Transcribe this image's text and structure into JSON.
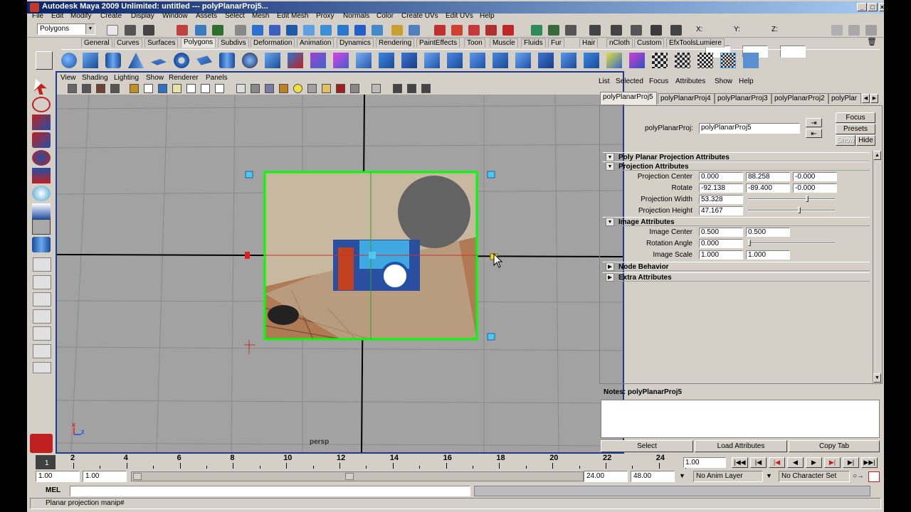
{
  "window": {
    "title": "Autodesk Maya 2009 Unlimited: untitled   ---   polyPlanarProj5...",
    "min_glyph": "_",
    "max_glyph": "□",
    "close_glyph": "×"
  },
  "menubar": [
    "File",
    "Edit",
    "Modify",
    "Create",
    "Display",
    "Window",
    "Assets",
    "Select",
    "Mesh",
    "Edit Mesh",
    "Proxy",
    "Normals",
    "Color",
    "Create UVs",
    "Edit UVs",
    "Help"
  ],
  "statusline": {
    "menu_set": "Polygons",
    "x_label": "X:",
    "y_label": "Y:",
    "z_label": "Z:"
  },
  "shelf_tabs": [
    "General",
    "Curves",
    "Surfaces",
    "Polygons",
    "Subdivs",
    "Deformation",
    "Animation",
    "Dynamics",
    "Rendering",
    "PaintEffects",
    "Toon",
    "Muscle",
    "Fluids",
    "Fur",
    "Hair",
    "nCloth",
    "Custom",
    "EfxToolsLumiere"
  ],
  "panel": {
    "menu": [
      "View",
      "Shading",
      "Lighting",
      "Show",
      "Renderer",
      "Panels"
    ],
    "camera_label": "persp",
    "axis_x": "x",
    "axis_z": "z"
  },
  "attribute_editor": {
    "menu": [
      "List",
      "Selected",
      "Focus",
      "Attributes",
      "Show",
      "Help"
    ],
    "tabs": [
      "polyPlanarProj5",
      "polyPlanarProj4",
      "polyPlanarProj3",
      "polyPlanarProj2",
      "polyPlar"
    ],
    "node_label": "polyPlanarProj:",
    "node_name": "polyPlanarProj5",
    "buttons": {
      "focus": "Focus",
      "presets": "Presets",
      "show": "Show",
      "hide": "Hide"
    },
    "sections": {
      "main": "Poly Planar Projection Attributes",
      "projection": "Projection Attributes",
      "image": "Image Attributes",
      "node_behavior": "Node Behavior",
      "extra": "Extra Attributes"
    },
    "projection_attrs": {
      "center_label": "Projection Center",
      "center": [
        "0.000",
        "88.258",
        "-0.000"
      ],
      "rotate_label": "Rotate",
      "rotate": [
        "-92.138",
        "-89.400",
        "-0.000"
      ],
      "width_label": "Projection Width",
      "width": "53.328",
      "width_slider": 0.7,
      "height_label": "Projection Height",
      "height": "47.167",
      "height_slider": 0.6
    },
    "image_attrs": {
      "center_label": "Image Center",
      "center": [
        "0.500",
        "0.500"
      ],
      "angle_label": "Rotation Angle",
      "angle": "0.000",
      "angle_slider": 0.0,
      "scale_label": "Image Scale",
      "scale": [
        "1.000",
        "1.000"
      ]
    },
    "notes_label": "Notes:  polyPlanarProj5",
    "bottom_buttons": [
      "Select",
      "Load Attributes",
      "Copy Tab"
    ]
  },
  "timeline": {
    "current_frame": "1",
    "ticks": [
      "2",
      "4",
      "6",
      "8",
      "10",
      "12",
      "14",
      "16",
      "18",
      "20",
      "22",
      "24"
    ],
    "current_time": "1.00"
  },
  "range": {
    "start_time": "1.00",
    "playback_start": "1.00",
    "playback_end": "24.00",
    "end_time": "48.00",
    "anim_layer": "No Anim Layer",
    "character_set": "No Character Set"
  },
  "command_line": {
    "label": "MEL"
  },
  "help_line": "Planar projection manip#",
  "colors": {
    "title_start": "#0a246a",
    "title_end": "#a6caf0",
    "viewport_bg": "#a2a2a2",
    "selection_green": "#00ff00",
    "manip_cyan": "#4fc8f0"
  }
}
